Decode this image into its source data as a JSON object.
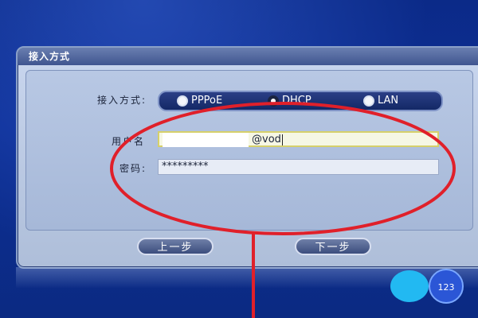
{
  "dialog": {
    "title": "接入方式",
    "access_label": "接入方式:",
    "options": [
      {
        "label": "PPPoE",
        "selected": false
      },
      {
        "label": "DHCP",
        "selected": true
      },
      {
        "label": "LAN",
        "selected": false
      }
    ],
    "username_label": "用户名",
    "username_value": "@vod",
    "password_label": "密码:",
    "password_value": "*********",
    "prev_button": "上一步",
    "next_button": "下一步"
  },
  "badge": "123",
  "colors": {
    "background": "#0d2f96",
    "annotation": "#e0202a",
    "selected_field_border": "#d6d06a"
  }
}
